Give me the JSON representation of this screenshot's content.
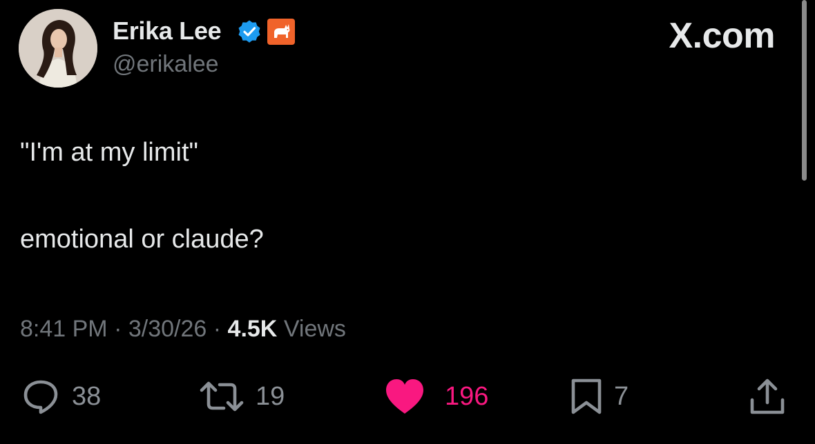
{
  "author": {
    "display_name": "Erika Lee",
    "handle": "@erikalee",
    "verified_icon": "verified-badge-icon",
    "affiliate_icon": "corgi-affiliate-icon"
  },
  "site": {
    "logo_text": "X.com"
  },
  "tweet": {
    "line_1": "\"I'm at my limit\"",
    "line_2": "emotional or claude?"
  },
  "meta": {
    "time": "8:41 PM",
    "separator": "·",
    "date": "3/30/26",
    "views_count": "4.5K",
    "views_label": "Views"
  },
  "actions": {
    "replies": "38",
    "reposts": "19",
    "likes": "196",
    "bookmarks": "7"
  },
  "icons": {
    "reply": "reply-icon",
    "repost": "repost-icon",
    "like": "heart-icon",
    "bookmark": "bookmark-icon",
    "share": "share-icon"
  },
  "colors": {
    "background": "#000000",
    "text": "#e7e9ea",
    "muted": "#71767b",
    "verified": "#1d9bf0",
    "like": "#f91880",
    "affiliate_badge": "#f0632a"
  }
}
